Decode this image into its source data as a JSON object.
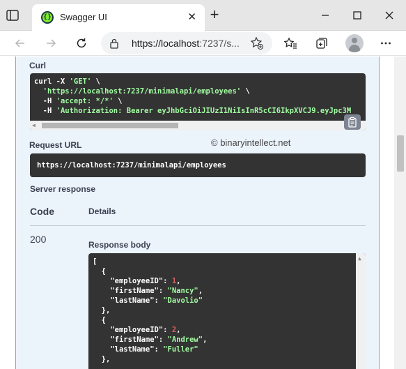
{
  "browser": {
    "tab_title": "Swagger UI",
    "tab_favicon_glyph": "{}",
    "new_tab_symbol": "+",
    "close_tab_symbol": "✕",
    "url_host": "https://localhost",
    "url_rest": ":7237/s...",
    "icons": [
      "tab-actions-icon",
      "back-icon",
      "forward-icon",
      "refresh-icon",
      "lock-icon",
      "add-favorite-icon",
      "favorites-icon",
      "collections-icon",
      "profile-avatar",
      "more-icon",
      "minimize-icon",
      "maximize-icon",
      "close-window-icon"
    ]
  },
  "curl": {
    "heading": "Curl",
    "line1_cmd": "curl -X ",
    "line1_method": "'GET'",
    "line1_end": " \\",
    "line2_url": "'https://localhost:7237/minimalapi/employees'",
    "line2_end": " \\",
    "line3_flag": "-H ",
    "line3_hdr": "'accept: */*'",
    "line3_end": " \\",
    "line4_flag": "-H ",
    "line4_hdr": "'Authorization: Bearer eyJhbGciOiJIUzI1NiIsInR5cCI6IkpXVCJ9.eyJpc3M"
  },
  "watermark": "© binaryintellect.net",
  "request_url": {
    "heading": "Request URL",
    "value": "https://localhost:7237/minimalapi/employees"
  },
  "server_response": {
    "heading": "Server response",
    "col_code": "Code",
    "col_details": "Details",
    "code": "200",
    "body_label": "Response body"
  },
  "response_body": {
    "employees": [
      {
        "employeeID": 1,
        "firstName": "Nancy",
        "lastName": "Davolio"
      },
      {
        "employeeID": 2,
        "firstName": "Andrew",
        "lastName": "Fuller"
      }
    ],
    "open_bracket": "[",
    "open_brace": "{",
    "close_brace_comma": "},",
    "key_id": "\"employeeID\"",
    "key_first": "\"firstName\"",
    "key_last": "\"lastName\"",
    "e1_id": "1",
    "e1_first": "\"Nancy\"",
    "e1_last": "\"Davolio\"",
    "e2_id": "2",
    "e2_first": "\"Andrew\"",
    "e2_last": "\"Fuller\""
  },
  "colors": {
    "get_accent": "#61affe",
    "block_bg": "#ebf3fb",
    "code_bg": "#333333",
    "string_green": "#a2fca2",
    "number_red": "#d36363"
  }
}
